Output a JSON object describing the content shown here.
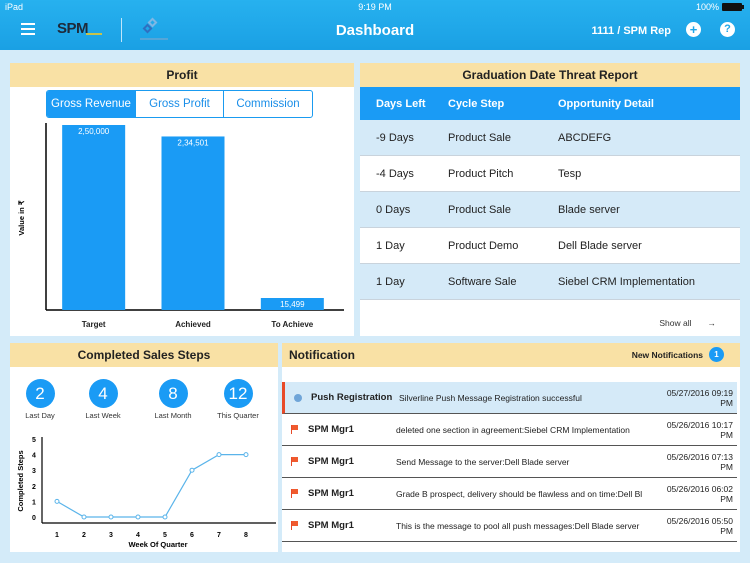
{
  "status_bar": {
    "device": "iPad",
    "time": "9:19 PM",
    "battery": "100%"
  },
  "header": {
    "logo_text": "SPM",
    "title": "Dashboard",
    "user": "1111 / SPM Rep"
  },
  "profit": {
    "title": "Profit",
    "tabs": [
      {
        "label": "Gross Revenue",
        "selected": true
      },
      {
        "label": "Gross Profit",
        "selected": false
      },
      {
        "label": "Commission",
        "selected": false
      }
    ]
  },
  "threat_report": {
    "title": "Graduation Date Threat Report",
    "columns": [
      "Days Left",
      "Cycle Step",
      "Opportunity Detail"
    ],
    "rows": [
      [
        "-9 Days",
        "Product Sale",
        "ABCDEFG"
      ],
      [
        "-4 Days",
        "Product Pitch",
        "Tesp"
      ],
      [
        "0 Days",
        "Product Sale",
        "Blade server"
      ],
      [
        "1 Day",
        "Product Demo",
        "Dell Blade server"
      ],
      [
        "1 Day",
        "Software Sale",
        "Siebel CRM Implementation"
      ]
    ],
    "show_all": "Show all",
    "arrow": "→"
  },
  "sales_steps": {
    "title": "Completed Sales Steps",
    "summary": [
      {
        "value": "2",
        "label": "Last Day"
      },
      {
        "value": "4",
        "label": "Last Week"
      },
      {
        "value": "8",
        "label": "Last Month"
      },
      {
        "value": "12",
        "label": "This Quarter"
      }
    ]
  },
  "notifications": {
    "title": "Notification",
    "new_label": "New Notifications",
    "new_count": "1",
    "items": [
      {
        "icon": "info",
        "title": "Push Registration",
        "message": "Silverline Push Message Registration successful",
        "date": "05/27/2016 09:19 PM",
        "active": true
      },
      {
        "icon": "flag",
        "title": "SPM Mgr1",
        "message": "deleted one section in agreement:Siebel CRM Implementation",
        "date": "05/26/2016 10:17 PM"
      },
      {
        "icon": "flag",
        "title": "SPM Mgr1",
        "message": "Send Message to the server:Dell Blade server",
        "date": "05/26/2016 07:13 PM"
      },
      {
        "icon": "flag",
        "title": "SPM Mgr1",
        "message": "Grade B prospect, delivery should be flawless and on time:Dell Bl",
        "date": "05/26/2016 06:02 PM"
      },
      {
        "icon": "flag",
        "title": "SPM Mgr1",
        "message": "This is the message to pool all push messages:Dell Blade server",
        "date": "05/26/2016 05:50 PM"
      }
    ]
  },
  "colors": {
    "accent": "#1a9bf5",
    "header_bg": "#f9e1a5",
    "topbar": "#1ea6e8",
    "alert": "#e84a28",
    "line": "#5ab4ea"
  },
  "chart_data": [
    {
      "type": "bar",
      "title": "",
      "xlabel": "",
      "ylabel": "Value in ₹",
      "categories": [
        "Target",
        "Achieved",
        "To Achieve"
      ],
      "values": [
        250000,
        234501,
        15499
      ],
      "labels": [
        "2,50,000",
        "2,34,501",
        "15,499"
      ],
      "ylim": [
        0,
        250000
      ],
      "grid": false
    },
    {
      "type": "line",
      "title": "",
      "xlabel": "Week Of Quarter",
      "ylabel": "Completed Steps",
      "x": [
        1,
        2,
        3,
        4,
        5,
        6,
        7,
        8
      ],
      "values": [
        1,
        0,
        0,
        0,
        0,
        3,
        4,
        4
      ],
      "ylim": [
        0,
        5
      ],
      "yticks": [
        0,
        1,
        2,
        3,
        4,
        5
      ],
      "grid": false
    }
  ]
}
